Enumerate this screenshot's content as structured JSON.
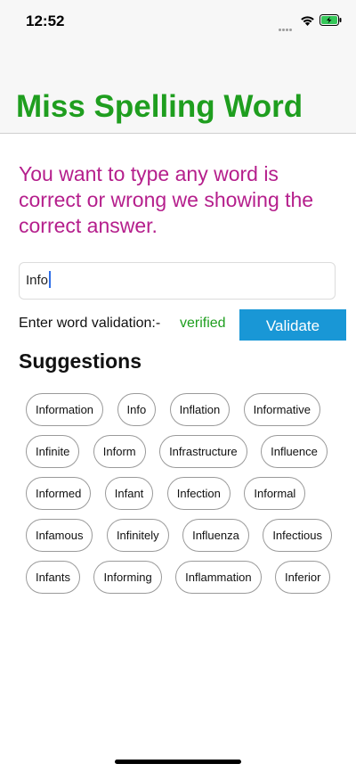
{
  "status_bar": {
    "time": "12:52",
    "icons": [
      "signal-dots-icon",
      "wifi-icon",
      "battery-charging-icon"
    ]
  },
  "nav": {
    "title": "Miss Spelling Word",
    "title_color": "#1f9e1f"
  },
  "intro": {
    "text": "You want to type any word is correct or wrong we showing the correct answer.",
    "color": "#b51f8c"
  },
  "input": {
    "value": "Info",
    "placeholder": ""
  },
  "validation": {
    "label": "Enter word validation:-",
    "status": "verified",
    "status_color": "#1f9e1f",
    "button_label": "Validate",
    "button_color": "#1997d6"
  },
  "suggestions": {
    "title": "Suggestions",
    "rows": [
      [
        "Information",
        "Info",
        "Inflation",
        "Informative"
      ],
      [
        "Infinite",
        "Inform",
        "Infrastructure",
        "Influence"
      ],
      [
        "Informed",
        "Infant",
        "Infection",
        "Informal"
      ],
      [
        "Infamous",
        "Infinitely",
        "Influenza",
        "Infectious"
      ],
      [
        "Infants",
        "Informing",
        "Inflammation",
        "Inferior"
      ]
    ]
  }
}
